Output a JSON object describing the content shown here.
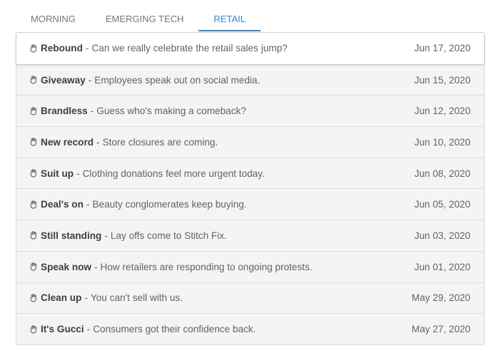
{
  "tabs": [
    {
      "label": "MORNING"
    },
    {
      "label": "EMERGING TECH"
    },
    {
      "label": "RETAIL"
    }
  ],
  "active_tab": "RETAIL",
  "accent_color": "#3a86c8",
  "item_icon": "hand-icon",
  "separator": "-",
  "items": [
    {
      "title": "Rebound",
      "desc": "Can we really celebrate the retail sales jump?",
      "date": "Jun 17, 2020"
    },
    {
      "title": "Giveaway",
      "desc": "Employees speak out on social media.",
      "date": "Jun 15, 2020"
    },
    {
      "title": "Brandless",
      "desc": "Guess who's making a comeback?",
      "date": "Jun 12, 2020"
    },
    {
      "title": "New record",
      "desc": "Store closures are coming.",
      "date": "Jun 10, 2020"
    },
    {
      "title": "Suit up",
      "desc": "Clothing donations feel more urgent today.",
      "date": "Jun 08, 2020"
    },
    {
      "title": "Deal's on",
      "desc": "Beauty conglomerates keep buying.",
      "date": "Jun 05, 2020"
    },
    {
      "title": "Still standing",
      "desc": "Lay offs come to Stitch Fix.",
      "date": "Jun 03, 2020"
    },
    {
      "title": "Speak now",
      "desc": "How retailers are responding to ongoing protests.",
      "date": "Jun 01, 2020"
    },
    {
      "title": "Clean up",
      "desc": "You can't sell with us.",
      "date": "May 29, 2020"
    },
    {
      "title": "It's Gucci",
      "desc": "Consumers got their confidence back.",
      "date": "May 27, 2020"
    }
  ]
}
